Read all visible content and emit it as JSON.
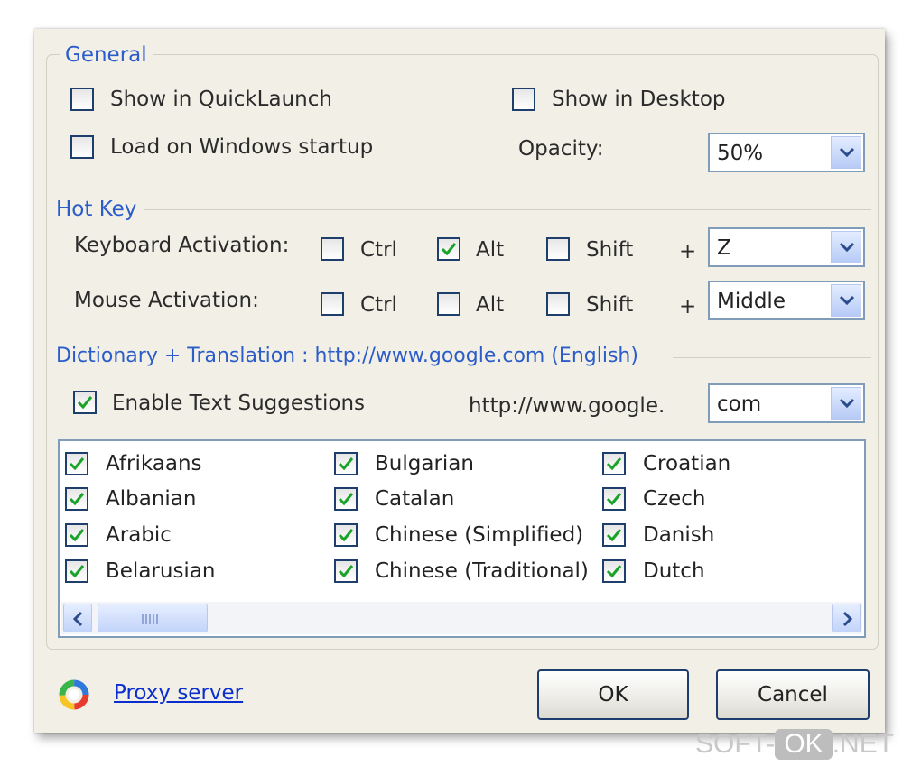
{
  "general": {
    "legend": "General",
    "show_quicklaunch": {
      "label": "Show in QuickLaunch",
      "checked": false
    },
    "show_desktop": {
      "label": "Show in Desktop",
      "checked": false
    },
    "load_startup": {
      "label": "Load on Windows startup",
      "checked": false
    },
    "opacity_label": "Opacity:",
    "opacity_value": "50%"
  },
  "hotkey": {
    "legend": "Hot Key",
    "keyboard_label": "Keyboard Activation:",
    "mouse_label": "Mouse Activation:",
    "ctrl": "Ctrl",
    "alt": "Alt",
    "shift": "Shift",
    "plus": "+",
    "keyboard": {
      "ctrl": false,
      "alt": true,
      "shift": false,
      "key": "Z"
    },
    "mouse": {
      "ctrl": false,
      "alt": false,
      "shift": false,
      "button": "Middle"
    }
  },
  "dictionary": {
    "legend": "Dictionary + Translation : http://www.google.com (English)",
    "enable_suggestions": {
      "label": "Enable Text Suggestions",
      "checked": true
    },
    "domain_prefix": "http://www.google.",
    "domain_value": "com",
    "languages": [
      "Afrikaans",
      "Albanian",
      "Arabic",
      "Belarusian",
      "Bulgarian",
      "Catalan",
      "Chinese (Simplified)",
      "Chinese (Traditional)",
      "Croatian",
      "Czech",
      "Danish",
      "Dutch"
    ],
    "languages_checked": true
  },
  "footer": {
    "proxy_link": "Proxy server",
    "ok": "OK",
    "cancel": "Cancel"
  },
  "watermark": {
    "left": "SOFT-",
    "mid": "OK",
    "right": ".NET"
  },
  "colors": {
    "accent_blue": "#2b5cc9",
    "dialog_bg": "#f1efe6",
    "check_green": "#1aa328",
    "link": "#0a2dcf"
  },
  "icons": {
    "app_logo": "color-ring-icon",
    "combo_arrow": "chevron-down-icon",
    "scroll_left": "chevron-left-icon",
    "scroll_right": "chevron-right-icon"
  }
}
